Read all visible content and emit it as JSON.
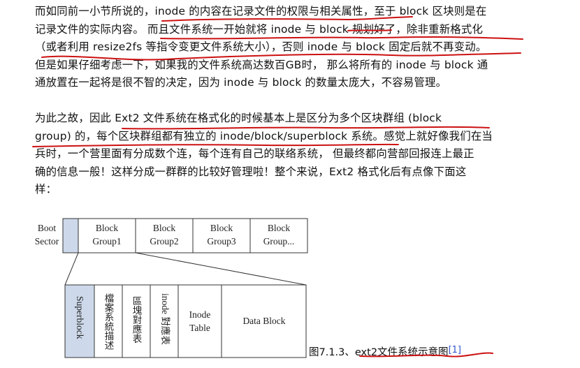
{
  "paragraph1": {
    "lines": [
      "而如同前一小节所说的，inode 的内容在记录文件的权限与相关属性，至于 block 区块则是在",
      "记录文件的实际内容。 而且文件系统一开始就将 inode 与 block 规划好了，除非重新格式化",
      "（或者利用 resize2fs 等指令变更文件系统大小），否则 inode 与 block 固定后就不再变动。",
      "但是如果仔细考虑一下，如果我的文件系统高达数百GB时， 那么将所有的 inode 与 block 通",
      "通放置在一起将是很不智的决定，因为 inode 与 block 的数量太庞大，不容易管理。"
    ]
  },
  "paragraph2": {
    "lines": [
      "为此之故，因此 Ext2 文件系统在格式化的时候基本上是区分为多个区块群组 (block",
      "group) 的，每个区块群组都有独立的 inode/block/superblock 系统。感觉上就好像我们在当",
      "兵时，一个营里面有分成数个连，每个连有自己的联络系统， 但最终都向营部回报连上最正",
      "确的信息一般！这样分成一群群的比较好管理啦！整个来说，Ext2 格式化后有点像下面这",
      "样："
    ]
  },
  "diagram": {
    "boot_sector": [
      "Boot",
      "Sector"
    ],
    "groups": [
      [
        "Block",
        "Group1"
      ],
      [
        "Block",
        "Group2"
      ],
      [
        "Block",
        "Group3"
      ],
      [
        "Block",
        "Group..."
      ]
    ],
    "detail_cells": {
      "superblock": "Superblock",
      "file_table": "檔案系統描述",
      "block_bitmap": "區塊對應表",
      "inode_bitmap": "inode 對應表",
      "inode_table": [
        "Inode",
        "Table"
      ],
      "data_block": "Data Block"
    }
  },
  "caption": {
    "text": "图7.1.3、ext2文件系统示意图",
    "ref": "[1]"
  },
  "colors": {
    "annotation_red": "#cc1111",
    "highlight_cell": "#cdd9ea",
    "link_blue": "#3355cc"
  }
}
